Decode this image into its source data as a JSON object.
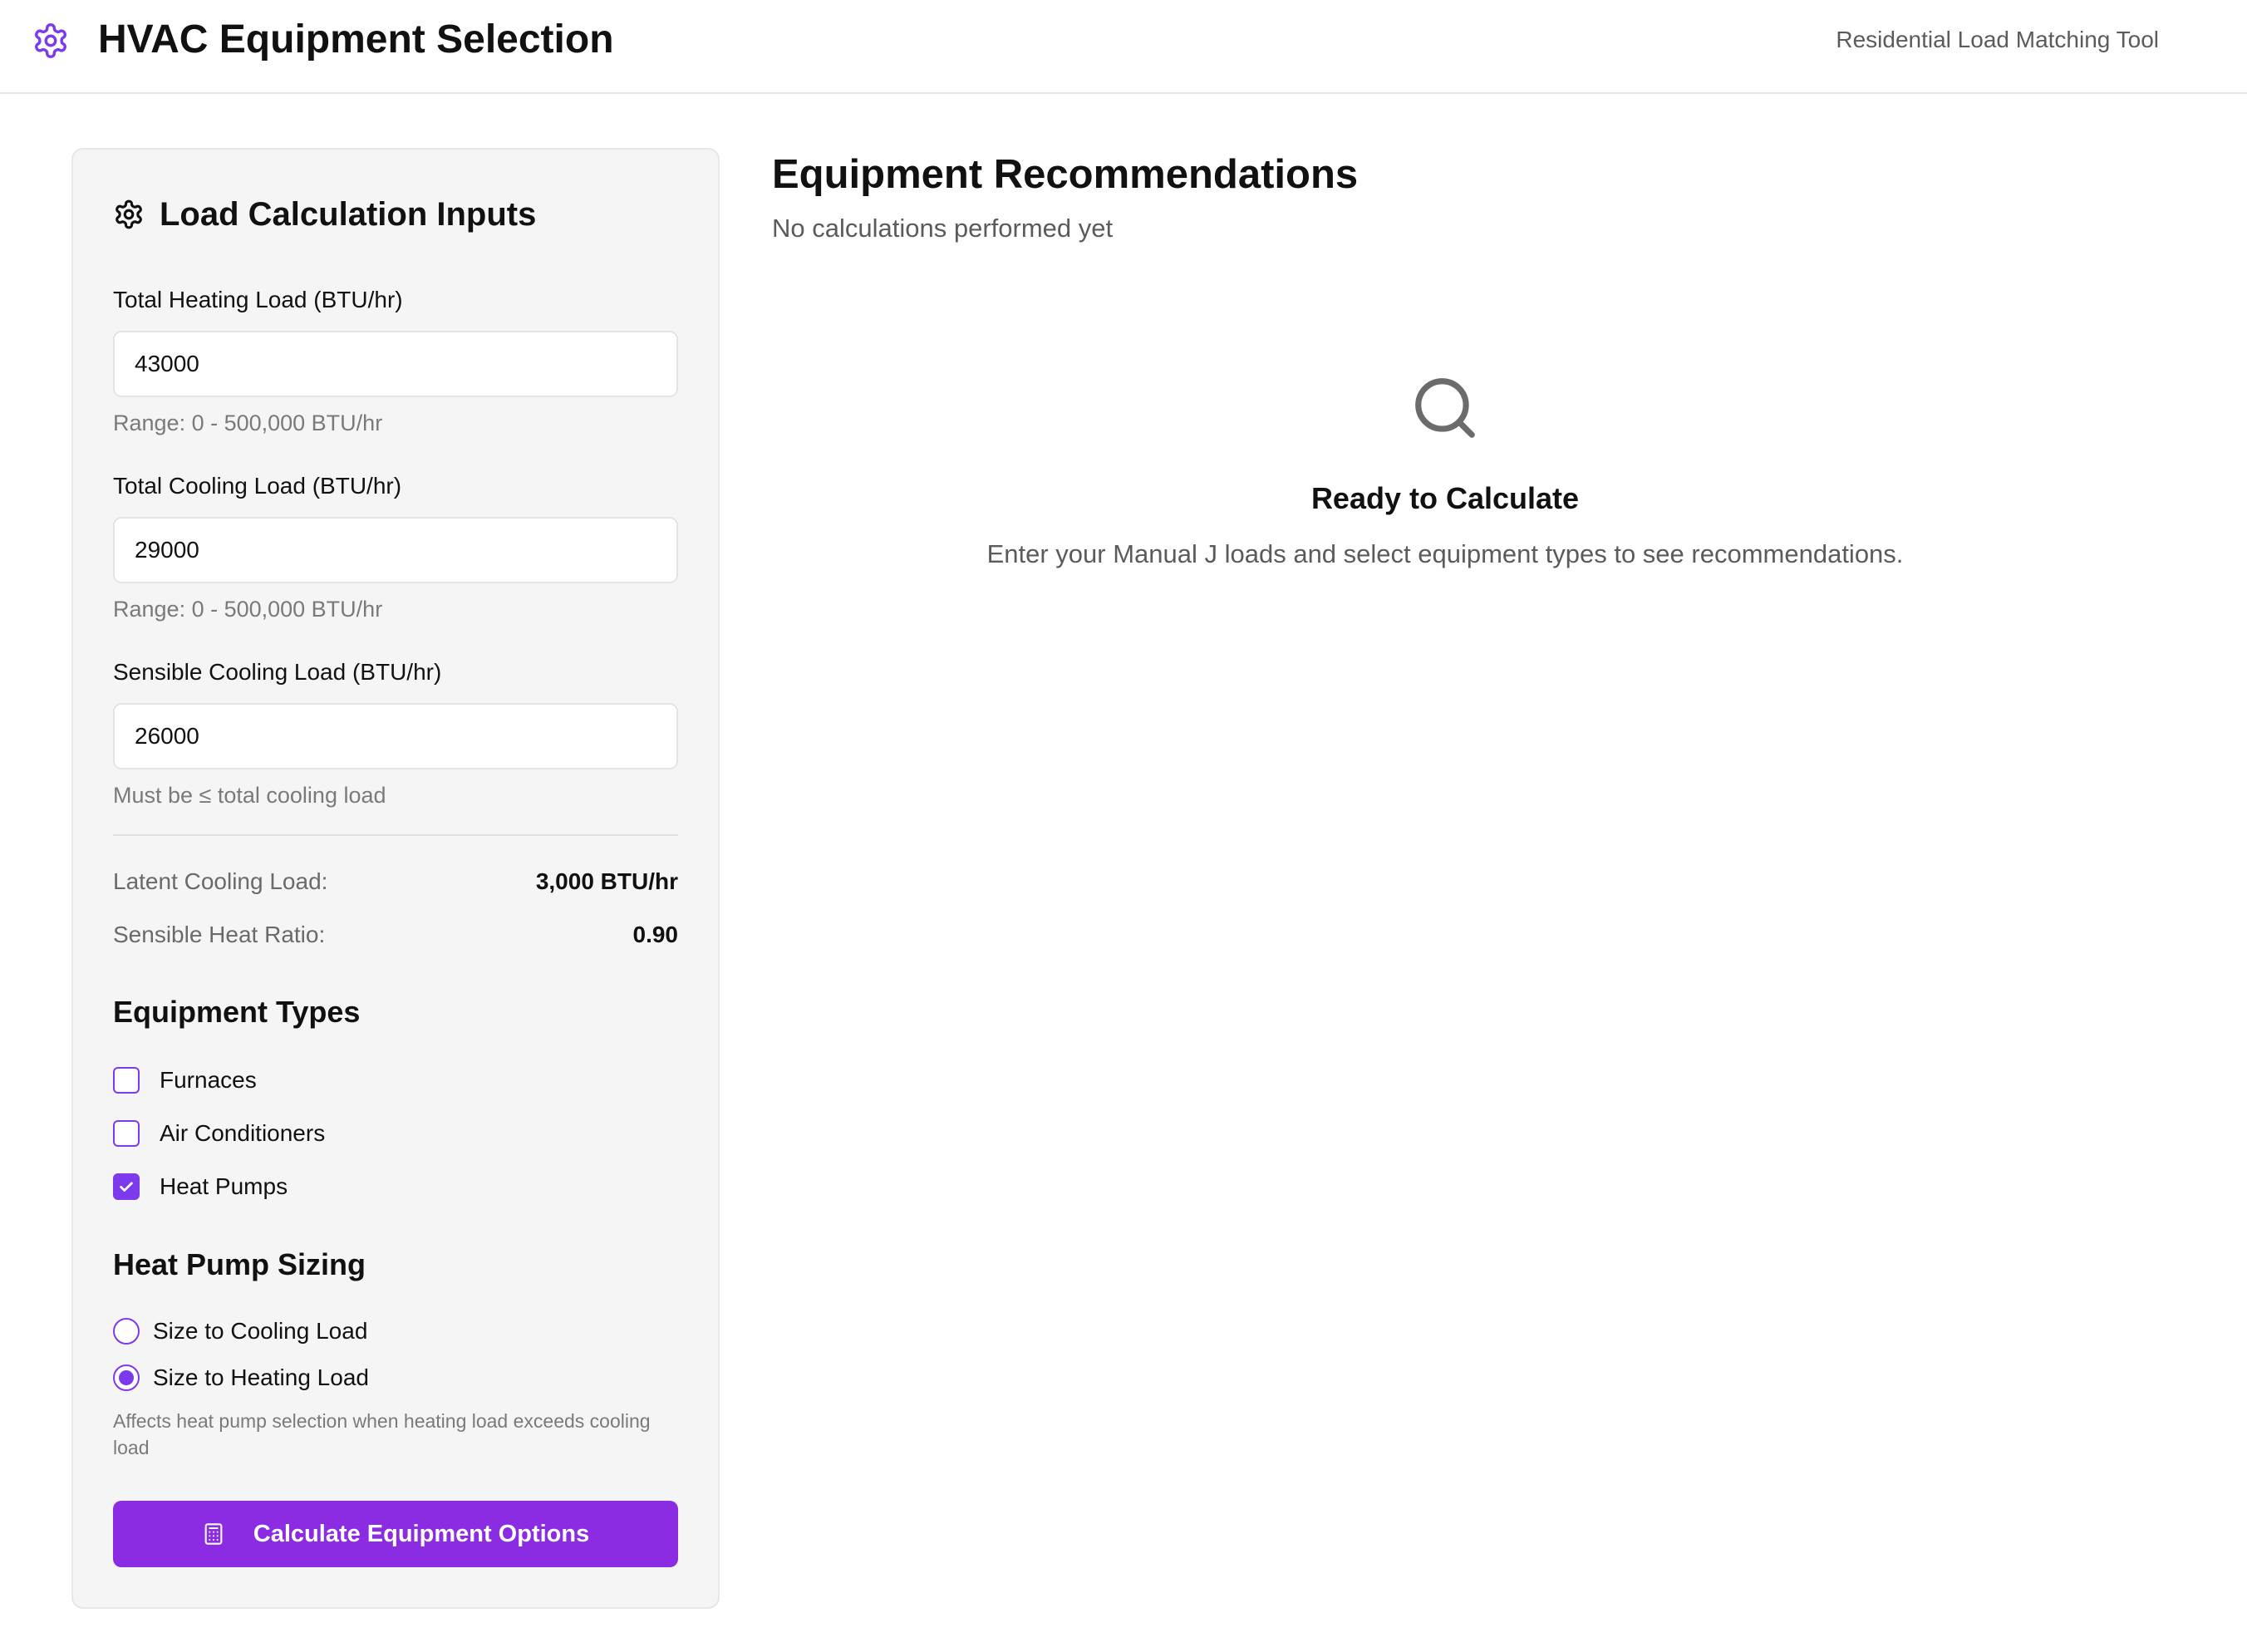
{
  "header": {
    "title": "HVAC Equipment Selection",
    "subtitle": "Residential Load Matching Tool",
    "logo_icon": "gear-icon",
    "accent_color": "#7c3aed"
  },
  "inputs_panel": {
    "title": "Load Calculation Inputs",
    "title_icon": "gear-icon",
    "heating": {
      "label": "Total Heating Load (BTU/hr)",
      "value": "43000",
      "hint": "Range: 0 - 500,000 BTU/hr"
    },
    "cooling": {
      "label": "Total Cooling Load (BTU/hr)",
      "value": "29000",
      "hint": "Range: 0 - 500,000 BTU/hr"
    },
    "sensible": {
      "label": "Sensible Cooling Load (BTU/hr)",
      "value": "26000",
      "hint": "Must be ≤ total cooling load"
    },
    "stats": {
      "latent_label": "Latent Cooling Load:",
      "latent_value": "3,000 BTU/hr",
      "shr_label": "Sensible Heat Ratio:",
      "shr_value": "0.90"
    },
    "equipment_types": {
      "heading": "Equipment Types",
      "options": [
        {
          "label": "Furnaces",
          "checked": false
        },
        {
          "label": "Air Conditioners",
          "checked": false
        },
        {
          "label": "Heat Pumps",
          "checked": true
        }
      ]
    },
    "heat_pump_sizing": {
      "heading": "Heat Pump Sizing",
      "options": [
        {
          "label": "Size to Cooling Load",
          "selected": false
        },
        {
          "label": "Size to Heating Load",
          "selected": true
        }
      ],
      "note": "Affects heat pump selection when heating load exceeds cooling load"
    },
    "calculate_button": {
      "label": "Calculate Equipment Options",
      "icon": "calculator-icon",
      "color": "#8b2be2"
    }
  },
  "recommendations": {
    "title": "Equipment Recommendations",
    "status": "No calculations performed yet",
    "empty_state": {
      "icon": "search-icon",
      "title": "Ready to Calculate",
      "description": "Enter your Manual J loads and select equipment types to see recommendations."
    }
  }
}
